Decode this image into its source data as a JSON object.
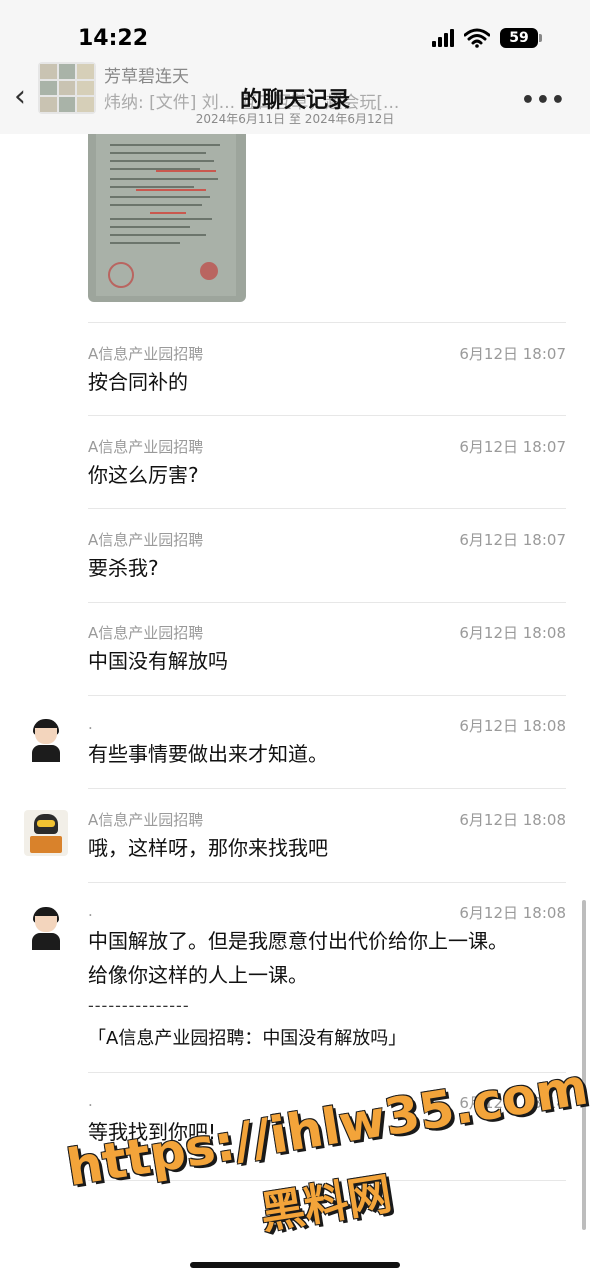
{
  "status_bar": {
    "time": "14:22",
    "battery": "59"
  },
  "header": {
    "group_name": "芳草碧连天",
    "notification_preview": "炜纳: [文件] 刘... 互口互草，超会玩[...",
    "title": "的聊天记录",
    "date_range": "2024年6月11日 至 2024年6月12日",
    "more": "•••",
    "back": "‹"
  },
  "messages": [
    {
      "sender": "A信息产业园招聘",
      "time": "6月12日 18:07",
      "text": "按合同补的"
    },
    {
      "sender": "A信息产业园招聘",
      "time": "6月12日 18:07",
      "text": "你这么厉害?"
    },
    {
      "sender": "A信息产业园招聘",
      "time": "6月12日 18:07",
      "text": "要杀我?"
    },
    {
      "sender": "A信息产业园招聘",
      "time": "6月12日 18:08",
      "text": "中国没有解放吗"
    },
    {
      "sender": ".",
      "time": "6月12日 18:08",
      "text": "有些事情要做出来才知道。"
    },
    {
      "sender": "A信息产业园招聘",
      "time": "6月12日 18:08",
      "text": "哦，这样呀，那你来找我吧"
    },
    {
      "sender": ".",
      "time": "6月12日 18:08",
      "text_line1": "中国解放了。但是我愿意付出代价给你上一课。",
      "text_line2": "给像你这样的人上一课。",
      "separator": "---------------",
      "quote": "「A信息产业园招聘：中国没有解放吗」"
    },
    {
      "sender": ".",
      "time": "6月12日 18:14",
      "text": "等我找到你吧!"
    }
  ],
  "watermark": {
    "url": "https://ihlw35.com",
    "site_name": "黑料网"
  },
  "colors": {
    "watermark": "#f3a43a",
    "header_bg": "#f6f6f6",
    "meta_text": "#9a9a9a"
  }
}
